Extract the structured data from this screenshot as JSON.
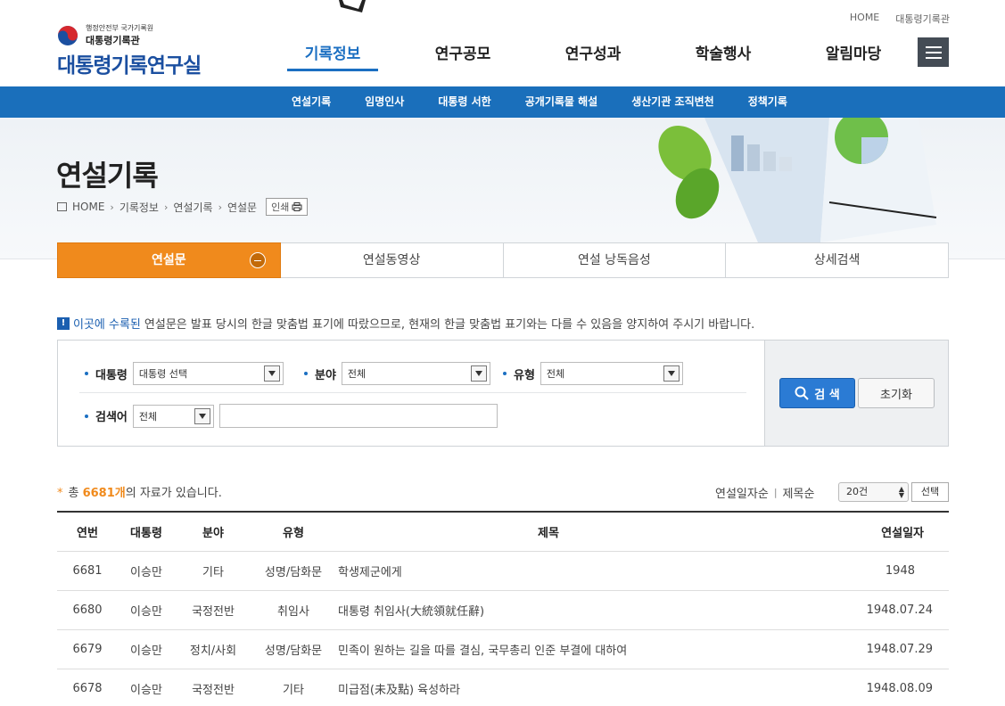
{
  "top_links": [
    "HOME",
    "대통령기록관"
  ],
  "logo": {
    "line1": "행정안전부 국가기록원",
    "line2": "대통령기록관",
    "title": "대통령기록연구실"
  },
  "gnb": [
    "기록정보",
    "연구공모",
    "연구성과",
    "학술행사",
    "알림마당"
  ],
  "sub_nav": [
    "연설기록",
    "임명인사",
    "대통령 서한",
    "공개기록물 해설",
    "생산기관 조직변천",
    "정책기록"
  ],
  "page": {
    "title": "연설기록",
    "breadcrumb": [
      "HOME",
      "기록정보",
      "연설기록",
      "연설문"
    ],
    "print_label": "인쇄"
  },
  "tabs": [
    "연설문",
    "연설동영상",
    "연설 낭독음성",
    "상세검색"
  ],
  "notice": {
    "icon": "!",
    "highlight": "이곳에 수록된",
    "text": " 연설문은 발표 당시의 한글 맞춤법 표기에 따랐으므로, 현재의 한글 맞춤법 표기와는 다를 수 있음을 양지하여 주시기 바랍니다."
  },
  "search": {
    "president_label": "대통령",
    "president_value": "대통령 선택",
    "field_label": "분야",
    "field_value": "전체",
    "type_label": "유형",
    "type_value": "전체",
    "keyword_label": "검색어",
    "keyword_scope": "전체",
    "keyword_value": "",
    "search_button": "검 색",
    "reset_button": "초기화"
  },
  "results": {
    "star": "*",
    "prefix": "총 ",
    "count": "6681개",
    "suffix": "의 자료가 있습니다.",
    "sort_date": "연설일자순",
    "sort_title": "제목순",
    "per_page": "20건",
    "choose_button": "선택"
  },
  "table": {
    "headers": [
      "연번",
      "대통령",
      "분야",
      "유형",
      "제목",
      "연설일자"
    ],
    "rows": [
      [
        "6681",
        "이승만",
        "기타",
        "성명/담화문",
        "학생제군에게",
        "1948"
      ],
      [
        "6680",
        "이승만",
        "국정전반",
        "취임사",
        "대통령 취임사(大統領就任辭)",
        "1948.07.24"
      ],
      [
        "6679",
        "이승만",
        "정치/사회",
        "성명/담화문",
        "민족이 원하는 길을 따를 결심, 국무총리 인준 부결에 대하여",
        "1948.07.29"
      ],
      [
        "6678",
        "이승만",
        "국정전반",
        "기타",
        "미급점(未及點) 육성하라",
        "1948.08.09"
      ]
    ]
  },
  "colors": {
    "brand_blue": "#1a6fbb",
    "tab_active": "#f08a1c",
    "search_button": "#2b7bd4"
  }
}
